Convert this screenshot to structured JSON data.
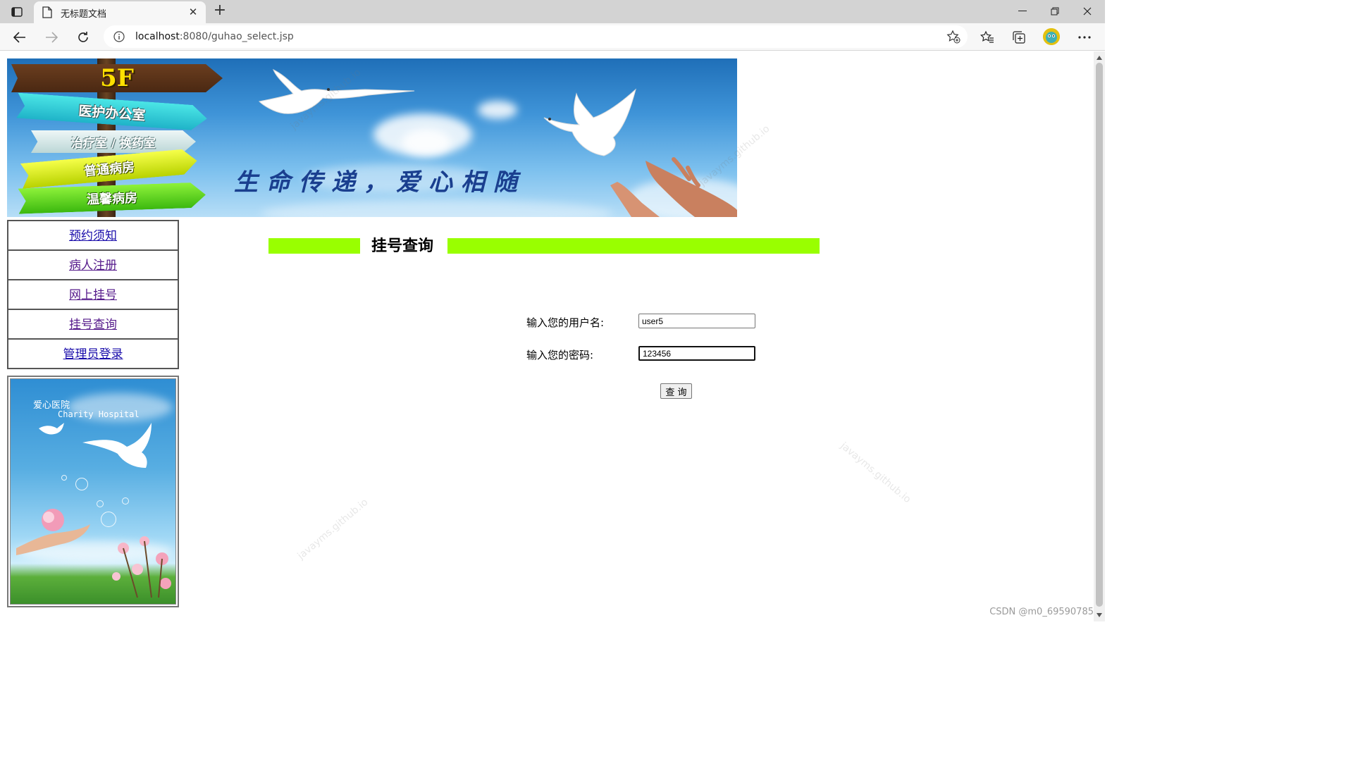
{
  "browser": {
    "tab_title": "无标题文档",
    "url_host": "localhost",
    "url_rest": ":8080/guhao_select.jsp"
  },
  "banner": {
    "floor": "5F",
    "signs": [
      "医护办公室",
      "治疗室 / 换药室",
      "普通病房",
      "温馨病房"
    ],
    "slogan": "生命传递，爱心相随"
  },
  "menu": {
    "items": [
      {
        "label": "预约须知"
      },
      {
        "label": "病人注册"
      },
      {
        "label": "网上挂号"
      },
      {
        "label": "挂号查询"
      },
      {
        "label": "管理员登录"
      }
    ]
  },
  "promo": {
    "name_cn": "爱心医院",
    "name_en": "Charity Hospital"
  },
  "main": {
    "title": "挂号查询",
    "username_label": "输入您的用户名:",
    "username_value": "user5",
    "password_label": "输入您的密码:",
    "password_value": "123456",
    "submit_label": "查 询"
  },
  "watermark": "javayms.github.io",
  "footer_credit": "CSDN @m0_69590785",
  "colors": {
    "title_bar": "#99ff00",
    "link": "#1a0dab"
  }
}
